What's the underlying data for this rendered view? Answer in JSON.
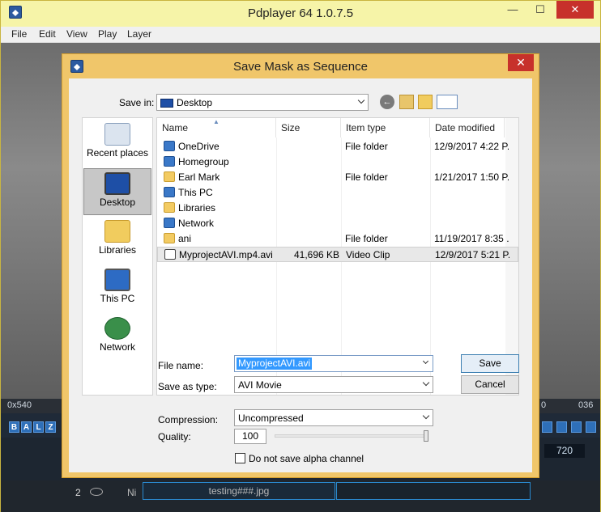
{
  "main_window": {
    "title": "Pdplayer 64 1.0.7.5",
    "menu": [
      "File",
      "Edit",
      "View",
      "Play",
      "Layer"
    ],
    "bg_resolution_text": "0x540",
    "bg_right_text_1": "0",
    "bg_right_text_2": "036",
    "bg_buttons": [
      "B",
      "A",
      "L",
      "Z"
    ],
    "bg_frame_value": "720",
    "track_number": "2",
    "track_name_short": "Ni",
    "track_filename": "testing###.jpg"
  },
  "dialog": {
    "title": "Save Mask as Sequence",
    "save_in_label": "Save in:",
    "save_in_value": "Desktop",
    "places": [
      {
        "label": "Recent places",
        "icon": "recent-places-icon"
      },
      {
        "label": "Desktop",
        "icon": "desktop-icon",
        "selected": true
      },
      {
        "label": "Libraries",
        "icon": "libraries-icon"
      },
      {
        "label": "This PC",
        "icon": "this-pc-icon"
      },
      {
        "label": "Network",
        "icon": "network-icon"
      }
    ],
    "columns": [
      "Name",
      "Size",
      "Item type",
      "Date modified"
    ],
    "files": [
      {
        "name": "OneDrive",
        "size": "",
        "type": "File folder",
        "date": "12/9/2017 4:22 P...",
        "icon": "onedrive-icon"
      },
      {
        "name": "Homegroup",
        "size": "",
        "type": "",
        "date": "",
        "icon": "homegroup-icon"
      },
      {
        "name": "Earl Mark",
        "size": "",
        "type": "File folder",
        "date": "1/21/2017 1:50 P...",
        "icon": "user-folder-icon"
      },
      {
        "name": "This PC",
        "size": "",
        "type": "",
        "date": "",
        "icon": "this-pc-icon"
      },
      {
        "name": "Libraries",
        "size": "",
        "type": "",
        "date": "",
        "icon": "libraries-icon"
      },
      {
        "name": "Network",
        "size": "",
        "type": "",
        "date": "",
        "icon": "network-icon"
      },
      {
        "name": "ani",
        "size": "",
        "type": "File folder",
        "date": "11/19/2017 8:35 ...",
        "icon": "folder-icon"
      },
      {
        "name": "MyprojectAVI.mp4.avi",
        "size": "41,696 KB",
        "type": "Video Clip",
        "date": "12/9/2017 5:21 P...",
        "icon": "video-file-icon",
        "selected": true
      }
    ],
    "file_name_label": "File name:",
    "file_name_value": "MyprojectAVI.avi",
    "save_as_type_label": "Save as type:",
    "save_as_type_value": "AVI Movie",
    "save_button": "Save",
    "cancel_button": "Cancel",
    "compression_label": "Compression:",
    "compression_value": "Uncompressed",
    "quality_label": "Quality:",
    "quality_value": "100",
    "quality_level_fraction": 1.0,
    "alpha_checkbox_label": "Do not save alpha channel",
    "alpha_checked": false
  },
  "colors": {
    "title_bar": "#f6f4a8",
    "dialog_frame": "#f0c66a",
    "close_red": "#c7312b",
    "selection_blue": "#3399ff"
  }
}
